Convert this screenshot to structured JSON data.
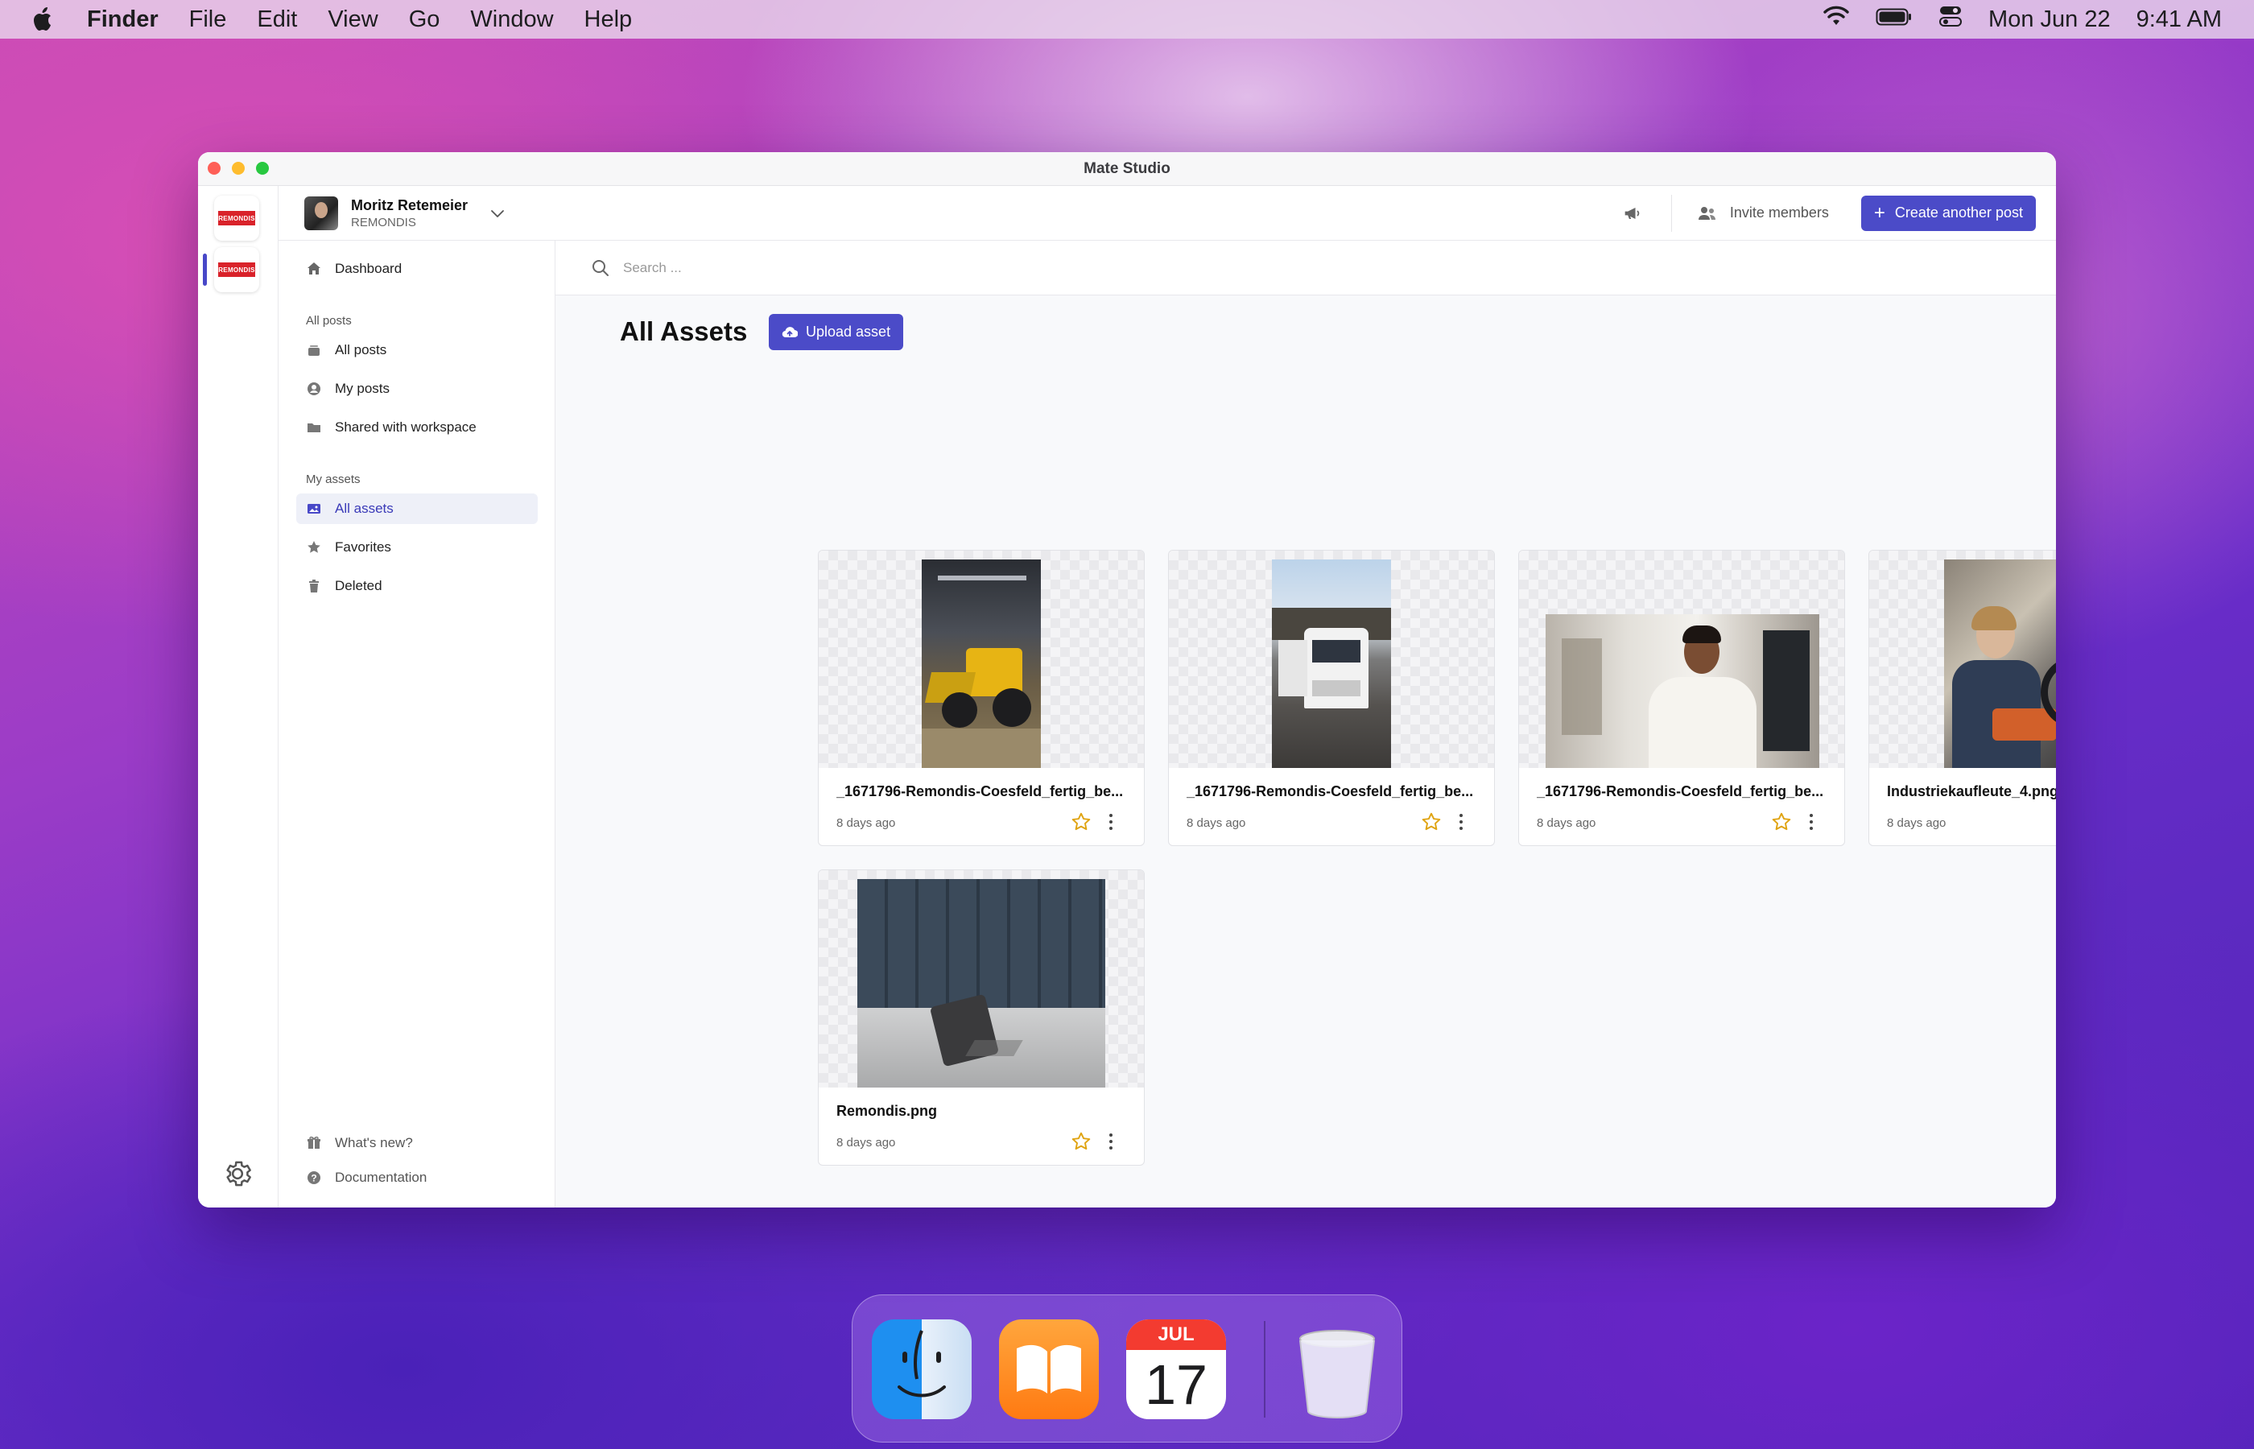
{
  "menubar": {
    "app": "Finder",
    "items": [
      "File",
      "Edit",
      "View",
      "Go",
      "Window",
      "Help"
    ],
    "date": "Mon Jun 22",
    "time": "9:41 AM"
  },
  "window": {
    "title": "Mate Studio"
  },
  "workspace_logo_text": "REMONDIS",
  "header": {
    "user_name": "Moritz Retemeier",
    "org": "REMONDIS",
    "invite_label": "Invite members",
    "create_label": "Create another post"
  },
  "sidebar": {
    "dashboard": "Dashboard",
    "posts_section": "All posts",
    "all_posts": "All posts",
    "my_posts": "My posts",
    "shared": "Shared with workspace",
    "assets_section": "My assets",
    "all_assets": "All assets",
    "favorites": "Favorites",
    "deleted": "Deleted",
    "whats_new": "What's new?",
    "documentation": "Documentation"
  },
  "search": {
    "placeholder": "Search ..."
  },
  "main": {
    "title": "All Assets",
    "upload_label": "Upload asset"
  },
  "assets": [
    {
      "name": "_1671796-Remondis-Coesfeld_fertig_be...",
      "date": "8 days ago"
    },
    {
      "name": "_1671796-Remondis-Coesfeld_fertig_be...",
      "date": "8 days ago"
    },
    {
      "name": "_1671796-Remondis-Coesfeld_fertig_be...",
      "date": "8 days ago"
    },
    {
      "name": "Industriekaufleute_4.png",
      "date": "8 days ago"
    },
    {
      "name": "Remondis.png",
      "date": "8 days ago"
    }
  ],
  "dock": {
    "calendar_month": "JUL",
    "calendar_day": "17"
  },
  "colors": {
    "accent": "#4b4bc8",
    "star": "#e0a412"
  }
}
